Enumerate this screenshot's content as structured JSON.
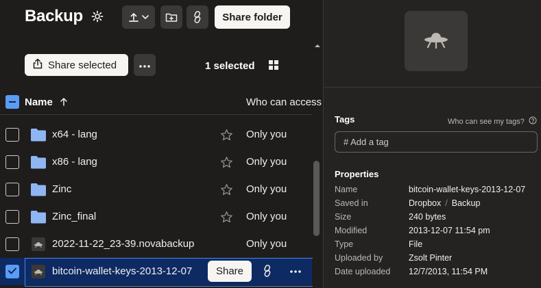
{
  "header": {
    "title": "Backup",
    "share_folder_label": "Share folder"
  },
  "toolbar": {
    "share_selected_label": "Share selected",
    "selected_count": "1 selected"
  },
  "table": {
    "columns": {
      "name": "Name",
      "access": "Who can access"
    },
    "rows": [
      {
        "name": "x64 - lang",
        "type": "folder",
        "access": "Only you",
        "selected": false
      },
      {
        "name": "x86 - lang",
        "type": "folder",
        "access": "Only you",
        "selected": false
      },
      {
        "name": "Zinc",
        "type": "folder",
        "access": "Only you",
        "selected": false
      },
      {
        "name": "Zinc_final",
        "type": "folder",
        "access": "Only you",
        "selected": false
      },
      {
        "name": "2022-11-22_23-39.novabackup",
        "type": "file",
        "access": "Only you",
        "selected": false
      },
      {
        "name": "bitcoin-wallet-keys-2013-12-07",
        "type": "file",
        "access": "",
        "selected": true,
        "share_label": "Share"
      }
    ]
  },
  "details": {
    "preview_icon": "ufo-icon",
    "tags": {
      "title": "Tags",
      "help": "Who can see my tags?",
      "placeholder": "# Add a tag"
    },
    "properties": {
      "title": "Properties",
      "name": {
        "label": "Name",
        "value": "bitcoin-wallet-keys-2013-12-07"
      },
      "saved_in": {
        "label": "Saved in",
        "parent": "Dropbox",
        "sep": "/",
        "folder": "Backup"
      },
      "size": {
        "label": "Size",
        "value": "240 bytes"
      },
      "modified": {
        "label": "Modified",
        "value": "2013-12-07 11:54 pm"
      },
      "type": {
        "label": "Type",
        "value": "File"
      },
      "uploaded_by": {
        "label": "Uploaded by",
        "value": "Zsolt Pinter"
      },
      "date_uploaded": {
        "label": "Date uploaded",
        "value": "12/7/2013, 11:54 PM"
      }
    }
  },
  "colors": {
    "background": "#1e1d1c",
    "panel": "#242322",
    "accent_blue": "#5a9bf6",
    "selected_row": "#0d2a63",
    "folder_blue": "#8fb6f2"
  }
}
